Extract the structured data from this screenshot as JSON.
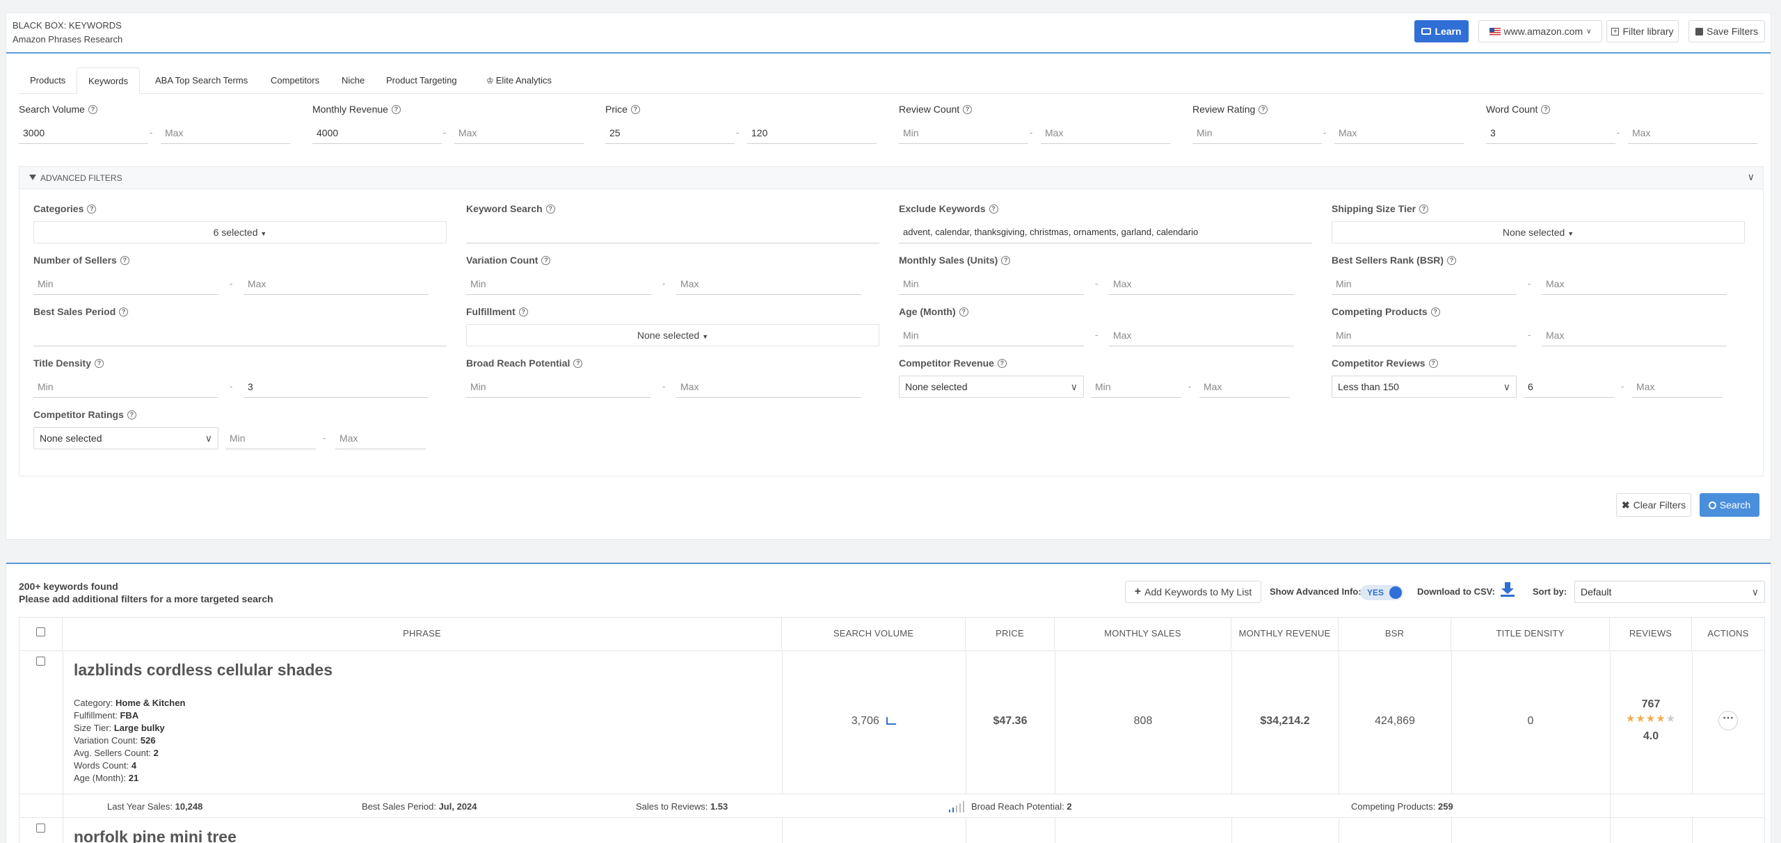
{
  "header": {
    "title": "BLACK BOX: KEYWORDS",
    "subtitle": "Amazon Phrases Research",
    "learn_label": "Learn",
    "marketplace": "www.amazon.com",
    "filter_library_label": "Filter library",
    "save_filters_label": "Save Filters"
  },
  "tabs": [
    {
      "label": "Products"
    },
    {
      "label": "Keywords",
      "active": true
    },
    {
      "label": "ABA Top Search Terms"
    },
    {
      "label": "Competitors"
    },
    {
      "label": "Niche"
    },
    {
      "label": "Product Targeting"
    },
    {
      "label": "Elite Analytics"
    }
  ],
  "filters": {
    "search_volume": {
      "label": "Search Volume",
      "min": "3000",
      "max_placeholder": "Max"
    },
    "monthly_revenue": {
      "label": "Monthly Revenue",
      "min": "4000",
      "max_placeholder": "Max"
    },
    "price": {
      "label": "Price",
      "min": "25",
      "max": "120"
    },
    "review_count": {
      "label": "Review Count",
      "min_placeholder": "Min",
      "max_placeholder": "Max"
    },
    "review_rating": {
      "label": "Review Rating",
      "min_placeholder": "Min",
      "max_placeholder": "Max"
    },
    "word_count": {
      "label": "Word Count",
      "min": "3",
      "max_placeholder": "Max"
    }
  },
  "advanced": {
    "title": "ADVANCED FILTERS",
    "categories": {
      "label": "Categories",
      "value": "6 selected"
    },
    "keyword_search": {
      "label": "Keyword Search",
      "value": ""
    },
    "exclude_keywords": {
      "label": "Exclude Keywords",
      "value": "advent, calendar, thanksgiving, christmas, ornaments, garland, calendario"
    },
    "shipping_size_tier": {
      "label": "Shipping Size Tier",
      "value": "None selected"
    },
    "number_of_sellers": {
      "label": "Number of Sellers"
    },
    "variation_count": {
      "label": "Variation Count"
    },
    "monthly_sales_units": {
      "label": "Monthly Sales (Units)"
    },
    "bsr": {
      "label": "Best Sellers Rank (BSR)"
    },
    "best_sales_period": {
      "label": "Best Sales Period"
    },
    "fulfillment": {
      "label": "Fulfillment",
      "value": "None selected"
    },
    "age_month": {
      "label": "Age (Month)"
    },
    "competing_products": {
      "label": "Competing Products"
    },
    "title_density": {
      "label": "Title Density",
      "max": "3"
    },
    "broad_reach_potential": {
      "label": "Broad Reach Potential"
    },
    "competitor_revenue": {
      "label": "Competitor Revenue",
      "select": "None selected"
    },
    "competitor_reviews": {
      "label": "Competitor Reviews",
      "select": "Less than 150",
      "min": "6"
    },
    "competitor_ratings": {
      "label": "Competitor Ratings",
      "select": "None selected"
    },
    "min_placeholder": "Min",
    "max_placeholder": "Max"
  },
  "actions": {
    "clear_label": "Clear Filters",
    "search_label": "Search"
  },
  "results": {
    "count_text": "200+ keywords found",
    "hint_text": "Please add additional filters for a more targeted search",
    "add_to_list_label": "Add Keywords to My List",
    "show_advanced_label": "Show Advanced Info:",
    "toggle_value": "YES",
    "download_label": "Download to CSV:",
    "sort_label": "Sort by:",
    "sort_value": "Default",
    "columns": [
      "PHRASE",
      "SEARCH VOLUME",
      "PRICE",
      "MONTHLY SALES",
      "MONTHLY REVENUE",
      "BSR",
      "TITLE DENSITY",
      "REVIEWS",
      "ACTIONS"
    ],
    "rows": [
      {
        "phrase": "lazblinds cordless cellular shades",
        "category": "Home & Kitchen",
        "fulfillment": "FBA",
        "size_tier": "Large bulky",
        "variation_count": "526",
        "avg_sellers": "2",
        "words_count": "4",
        "age_month": "21",
        "search_volume": "3,706",
        "price": "$47.36",
        "monthly_sales": "808",
        "monthly_revenue": "$34,214.2",
        "bsr": "424,869",
        "title_density": "0",
        "reviews": "767",
        "rating": "4.0",
        "last_year_sales": "10,248",
        "best_sales_period": "Jul, 2024",
        "sales_to_reviews": "1.53",
        "broad_reach_potential": "2",
        "competing_products": "259"
      },
      {
        "phrase": "norfolk pine mini tree"
      }
    ],
    "meta_labels": {
      "category": "Category:",
      "fulfillment": "Fulfillment:",
      "size_tier": "Size Tier:",
      "variation_count": "Variation Count:",
      "avg_sellers": "Avg. Sellers Count:",
      "words_count": "Words Count:",
      "age_month": "Age (Month):",
      "last_year_sales": "Last Year Sales:",
      "best_sales_period": "Best Sales Period:",
      "sales_to_reviews": "Sales to Reviews:",
      "broad_reach_potential": "Broad Reach Potential:",
      "competing_products": "Competing Products:"
    }
  }
}
